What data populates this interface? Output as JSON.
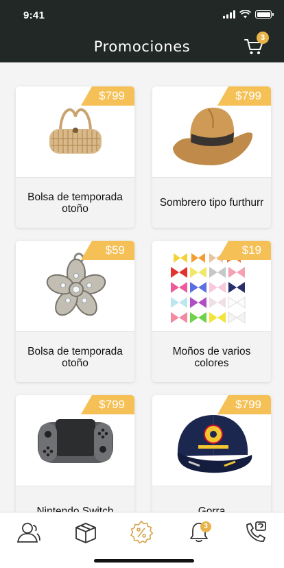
{
  "status": {
    "time": "9:41"
  },
  "header": {
    "title": "Promociones",
    "cart_count": "3",
    "cart_icon": "cart-icon"
  },
  "products": [
    {
      "name": "Bolsa de temporada otoño",
      "price": "$799",
      "image": "wicker-bag"
    },
    {
      "name": "Sombrero tipo furthurr",
      "price": "$799",
      "image": "straw-hat"
    },
    {
      "name": "Bolsa de temporada otoño",
      "price": "$59",
      "image": "flower-charm"
    },
    {
      "name": "Moños de varios colores",
      "price": "$19",
      "image": "hair-bows"
    },
    {
      "name": "Nintendo Switch",
      "price": "$799",
      "image": "game-controller"
    },
    {
      "name": "Gorra",
      "price": "$799",
      "image": "baseball-cap"
    }
  ],
  "tabbar": {
    "items": [
      {
        "icon": "profile-icon"
      },
      {
        "icon": "box-icon"
      },
      {
        "icon": "discount-icon",
        "active": true
      },
      {
        "icon": "bell-icon",
        "badge": "3"
      },
      {
        "icon": "support-phone-icon"
      }
    ]
  },
  "colors": {
    "header_bg": "#222826",
    "accent": "#f5c056",
    "badge": "#e8b44a"
  }
}
